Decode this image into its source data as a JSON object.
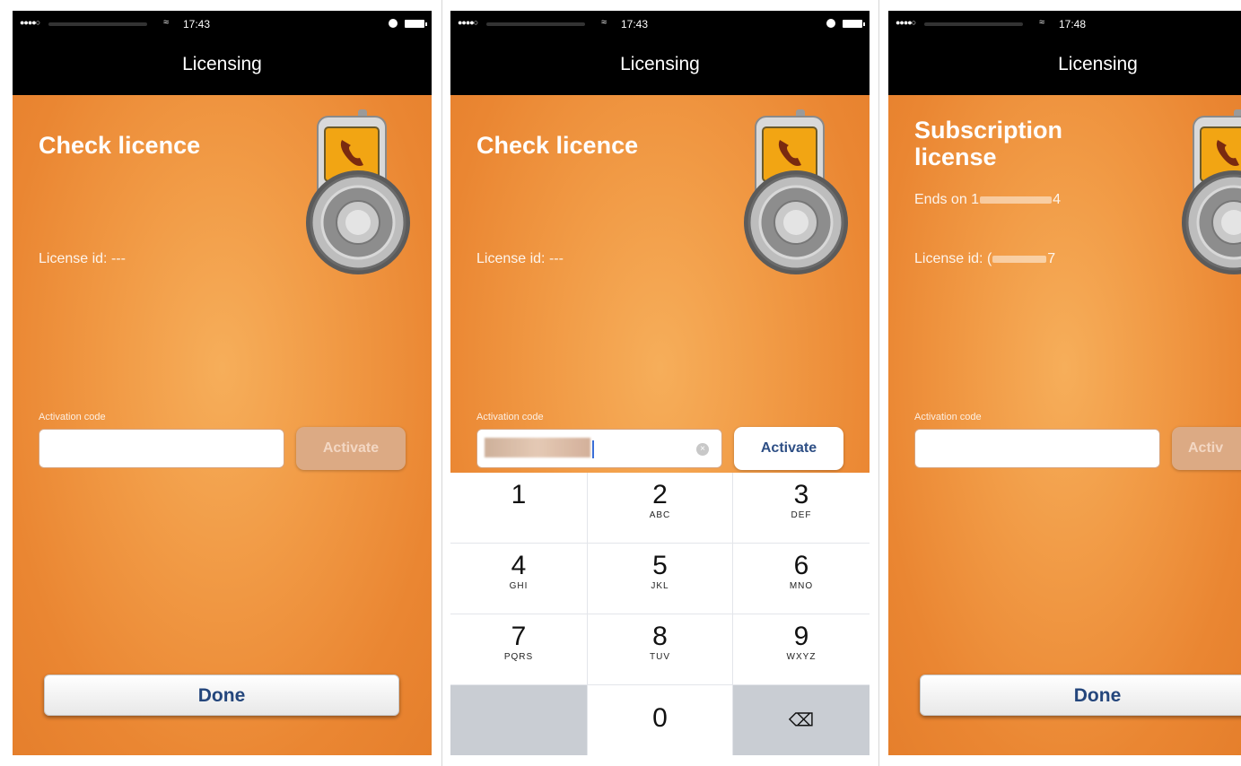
{
  "screens": [
    {
      "status_time": "17:43",
      "nav_title": "Licensing",
      "heading": "Check licence",
      "license_id": "License id: ---",
      "activation_label": "Activation code",
      "activate_label": "Activate",
      "done_label": "Done"
    },
    {
      "status_time": "17:43",
      "nav_title": "Licensing",
      "heading": "Check licence",
      "license_id": "License id: ---",
      "activation_label": "Activation code",
      "activate_label": "Activate",
      "keypad": [
        {
          "num": "1",
          "letters": ""
        },
        {
          "num": "2",
          "letters": "ABC"
        },
        {
          "num": "3",
          "letters": "DEF"
        },
        {
          "num": "4",
          "letters": "GHI"
        },
        {
          "num": "5",
          "letters": "JKL"
        },
        {
          "num": "6",
          "letters": "MNO"
        },
        {
          "num": "7",
          "letters": "PQRS"
        },
        {
          "num": "8",
          "letters": "TUV"
        },
        {
          "num": "9",
          "letters": "WXYZ"
        },
        {
          "num": "0",
          "letters": ""
        }
      ]
    },
    {
      "status_time": "17:48",
      "nav_title": "Licensing",
      "heading_line1": "Subscription",
      "heading_line2": "license",
      "ends_prefix": "Ends on 1",
      "ends_suffix": "4",
      "license_prefix": "License id: (",
      "license_suffix": "7",
      "activation_label": "Activation code",
      "activate_label": "Activ",
      "done_label": "Done"
    }
  ],
  "colors": {
    "background_orange": "#f19a45",
    "nav_black": "#000000",
    "done_text": "#24467c",
    "activate_enabled_text": "#2e4f85"
  },
  "icons": [
    "signal-icon",
    "wifi-icon",
    "lock-rotation-icon",
    "battery-icon",
    "phone-lock-icon",
    "backspace-icon",
    "clear-text-icon"
  ]
}
